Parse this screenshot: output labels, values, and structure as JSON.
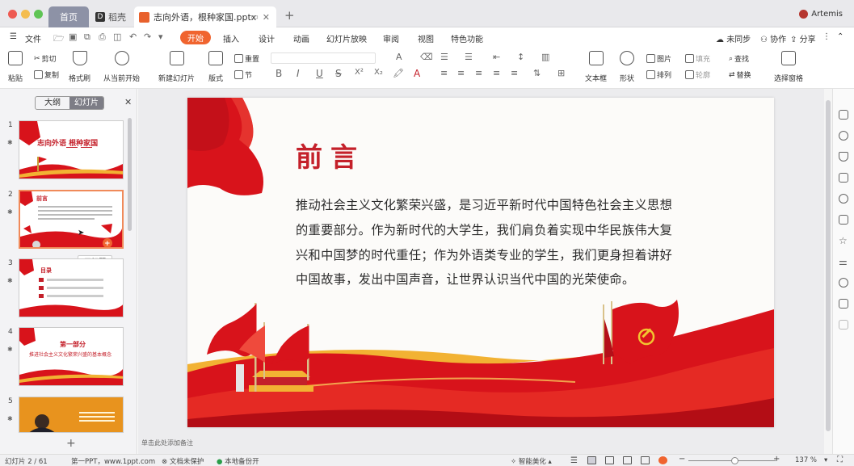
{
  "titlebar": {
    "tab_home": "首页",
    "tab_shell": "稻壳",
    "tab_doc": "志向外语，根种家国.pptx",
    "user": "Artemis",
    "colors": {
      "red_dot": "#ee5a52",
      "yellow_dot": "#f4bd4f",
      "green_dot": "#5fc454"
    }
  },
  "menubar": {
    "file": "文件",
    "items": [
      "开始",
      "插入",
      "设计",
      "动画",
      "幻灯片放映",
      "审阅",
      "视图",
      "特色功能"
    ],
    "right": [
      "未同步",
      "协作",
      "分享"
    ]
  },
  "ribbon": {
    "paste": "粘贴",
    "cut": "剪切",
    "copy": "复制",
    "format_painter": "格式刷",
    "from_start": "从当前开始",
    "new_slide": "新建幻灯片",
    "layout": "版式",
    "reset": "重置",
    "section": "节",
    "text_box": "文本框",
    "shape": "形状",
    "arrange": "排列",
    "picture": "图片",
    "fill": "填充",
    "outline": "轮廓",
    "find": "查找",
    "replace": "替换",
    "select_pane": "选择窗格",
    "format_symbols": [
      "B",
      "I",
      "U",
      "S",
      "X²",
      "X₂"
    ]
  },
  "leftpanel": {
    "outline_tab": "大纲",
    "slides_tab": "幻灯片",
    "tooltip": "无标题",
    "slide_numbers": [
      "1",
      "2",
      "3",
      "4",
      "5"
    ],
    "thumb1_title": "志向外语 根种家国",
    "thumb2_title": "前言",
    "thumb3_title": "目录",
    "thumb4_title": "第一部分",
    "thumb4_sub": "推进社会主义文化繁荣兴盛的基本概念"
  },
  "slide": {
    "title": "前言",
    "lines": [
      "推动社会主义文化繁荣兴盛，是习近平新时代中国特色社会主义思想",
      "的重要部分。作为新时代的大学生，我们肩负着实现中华民族伟大复",
      "兴和中国梦的时代重任；作为外语类专业的学生，我们更身担着讲好",
      "中国故事，发出中国声音，让世界认识当代中国的光荣使命。"
    ],
    "colors": {
      "title": "#c4202a",
      "flag_red": "#d8131b",
      "gold": "#f2b233"
    }
  },
  "notes_placeholder": "单击此处添加备注",
  "statusbar": {
    "slide_count": "幻灯片 2 / 61",
    "theme": "第一PPT，www.1ppt.com",
    "protection": "文档未保护",
    "backup": "本地备份开",
    "beautify": "智能美化",
    "zoom": "137 %"
  }
}
